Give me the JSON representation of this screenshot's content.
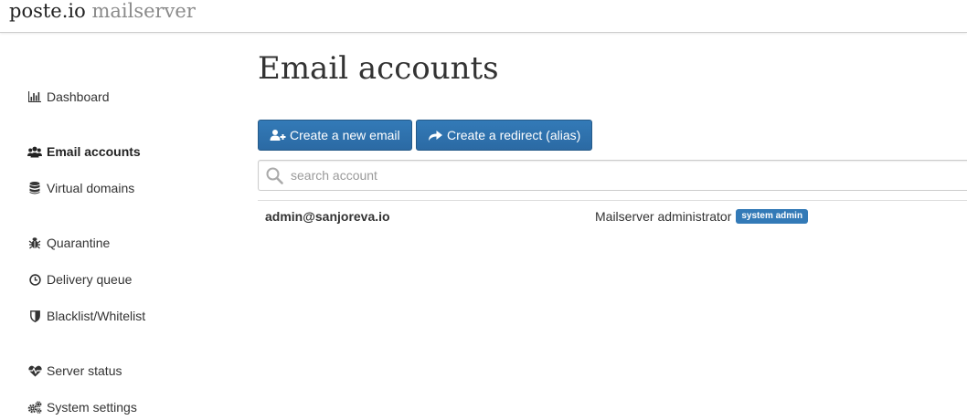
{
  "brand": {
    "name": "poste.io",
    "product": "mailserver"
  },
  "sidebar": {
    "items": [
      {
        "label": "Dashboard",
        "icon": "bar-chart-icon"
      },
      {
        "label": "Email accounts",
        "icon": "users-icon",
        "active": true
      },
      {
        "label": "Virtual domains",
        "icon": "database-icon"
      },
      {
        "label": "Quarantine",
        "icon": "bug-icon"
      },
      {
        "label": "Delivery queue",
        "icon": "clock-icon"
      },
      {
        "label": "Blacklist/Whitelist",
        "icon": "shield-icon"
      },
      {
        "label": "Server status",
        "icon": "heartbeat-icon"
      },
      {
        "label": "System settings",
        "icon": "gears-icon"
      }
    ]
  },
  "main": {
    "title": "Email accounts",
    "buttons": {
      "create_email": "Create a new email",
      "create_redirect": "Create a redirect (alias)"
    },
    "search": {
      "placeholder": "search account",
      "value": ""
    },
    "accounts": [
      {
        "email": "admin@sanjoreva.io",
        "name": "Mailserver administrator",
        "badge": "system admin"
      }
    ]
  },
  "colors": {
    "primary": "#337ab7",
    "text": "#333333",
    "brand_muted": "#8a8a8a"
  }
}
